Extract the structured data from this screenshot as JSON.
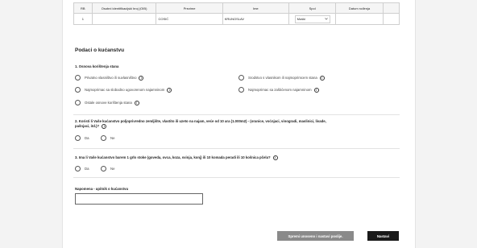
{
  "table": {
    "headers": [
      "RB",
      "Osobni identifikacijski broj (OIB)",
      "Prezime",
      "Ime",
      "Spol",
      "Datum rođenja"
    ],
    "row": {
      "rb": "1",
      "oib": "",
      "prezime": "COSIĆ",
      "ime": "KRUNOSLAV",
      "spol": "Muški",
      "datum": ""
    }
  },
  "section_title": "Podaci o kućanstvu",
  "q1": {
    "title": "1. Osnova korištenja stana",
    "options": [
      "Privatno vlasništvo ili suvlasništvo",
      "Srodstvo s vlasnikom ili najmoprimcem stana",
      "Najmoprimac sa slobodno ugovorenom najamninom",
      "Najmoprimac sa zaštićenom najamninom",
      "Ostale osnove korištenja stana"
    ]
  },
  "q2": {
    "title_line1": "2. Koristi li Vaše kućanstvo poljoprivredno zemljište, vlastito ili uzeto na najam, veće od 10 ara (1.000m2) - (oranice, voćnjaci, vinogradi, maslinici, livade,",
    "title_line2": "pašnjaci, itd.)?",
    "yes": "Da",
    "no": "Ne"
  },
  "q3": {
    "title": "3. Ima li Vaše kućanstvo barem 1 grlo stoke (goveda, ovca, koza, svinja, konj) ili 10 komada peradi ili 10 košnica pčela?",
    "yes": "Da",
    "no": "Ne"
  },
  "note": {
    "label": "Napomena - upitnik o kućanstvu",
    "value": ""
  },
  "buttons": {
    "save": "Spremi unoseno i nastavi poslije.",
    "next": "Nastavi"
  },
  "icons": {
    "info": "i"
  }
}
